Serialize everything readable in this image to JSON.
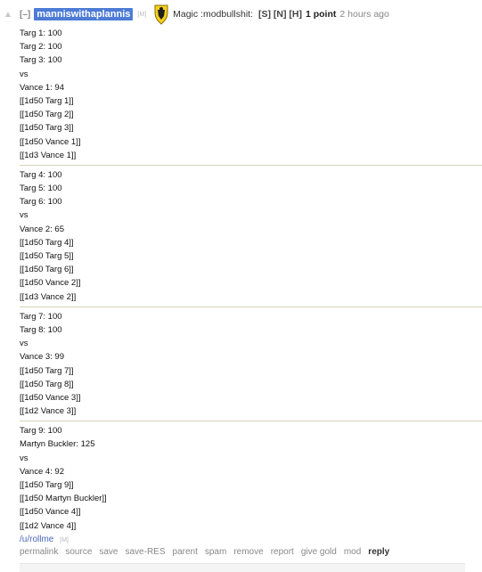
{
  "comment": {
    "collapse_label": "[–]",
    "author": "manniswithaplannis",
    "author_tag": "[M]",
    "flair_text": "Magic :modbullshit:",
    "user_attrs": "[S] [N] [H]",
    "score": "1 point",
    "time": "2 hours ago",
    "blocks": [
      [
        "Targ 1: 100",
        "Targ 2: 100",
        "Targ 3: 100",
        "vs",
        "Vance 1: 94",
        "[[1d50 Targ 1]]",
        "[[1d50 Targ 2]]",
        "[[1d50 Targ 3]]",
        "[[1d50 Vance 1]]",
        "[[1d3 Vance 1]]"
      ],
      [
        "Targ 4: 100",
        "Targ 5: 100",
        "Targ 6: 100",
        "vs",
        "Vance 2: 65",
        "[[1d50 Targ 4]]",
        "[[1d50 Targ 5]]",
        "[[1d50 Targ 6]]",
        "[[1d50 Vance 2]]",
        "[[1d3 Vance 2]]"
      ],
      [
        "Targ 7: 100",
        "Targ 8: 100",
        "vs",
        "Vance 3: 99",
        "[[1d50 Targ 7]]",
        "[[1d50 Targ 8]]",
        "[[1d50 Vance 3]]",
        "[[1d2 Vance 3]]"
      ],
      [
        "Targ 9: 100",
        "Martyn Buckler: 125",
        "vs",
        "Vance 4: 92",
        "[[1d50 Targ 9]]",
        "[[1d50 Martyn Buckler]]",
        "[[1d50 Vance 4]]",
        "[[1d2 Vance 4]]"
      ]
    ],
    "footer_link": "/u/rollme",
    "footer_tag": "[M]",
    "buttons": [
      "permalink",
      "source",
      "save",
      "save-RES",
      "parent",
      "spam",
      "remove",
      "report",
      "give gold",
      "mod",
      "reply"
    ]
  },
  "colors": {
    "author_bg": "#4d7bd6",
    "link": "#4b66b6",
    "divider": "#d7d2b8"
  },
  "icons": {
    "upvote": "up-arrow-icon",
    "flair": "yellow-shield-crest-icon"
  }
}
